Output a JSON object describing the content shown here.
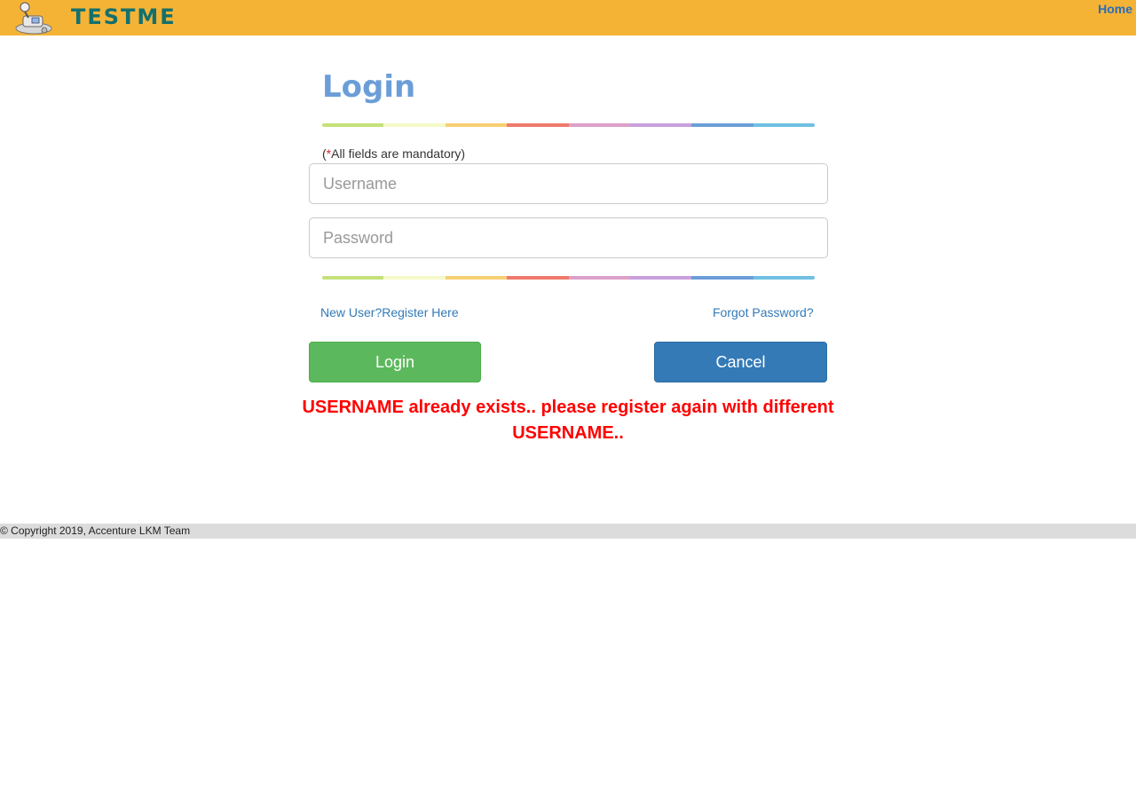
{
  "header": {
    "logo_icon": "robot-mascot-icon",
    "logo_text": "TESTME",
    "home_link": "Home",
    "background": "#f5b335",
    "logo_text_color": "#13706e"
  },
  "login": {
    "title": "Login",
    "mandatory_prefix": "(",
    "mandatory_star": "*",
    "mandatory_text": "All fields are mandatory)",
    "username_placeholder": "Username",
    "password_placeholder": "Password",
    "register_link": "New User?Register Here",
    "forgot_link": "Forgot Password?",
    "login_button": "Login",
    "cancel_button": "Cancel",
    "error_message": "USERNAME already exists.. please register again with different USERNAME.."
  },
  "colors": {
    "title": "#6b9ed8",
    "login_button": "#5cb85c",
    "cancel_button": "#337ab7",
    "error": "#ff0000",
    "rainbow": [
      "#c5e17a",
      "#f5f9c8",
      "#f7cf74",
      "#ef7a6c",
      "#dda0c8",
      "#c8a0dc",
      "#6b9ed8",
      "#6fc0e2"
    ]
  },
  "footer": {
    "copyright": "© Copyright 2019, Accenture LKM Team"
  }
}
